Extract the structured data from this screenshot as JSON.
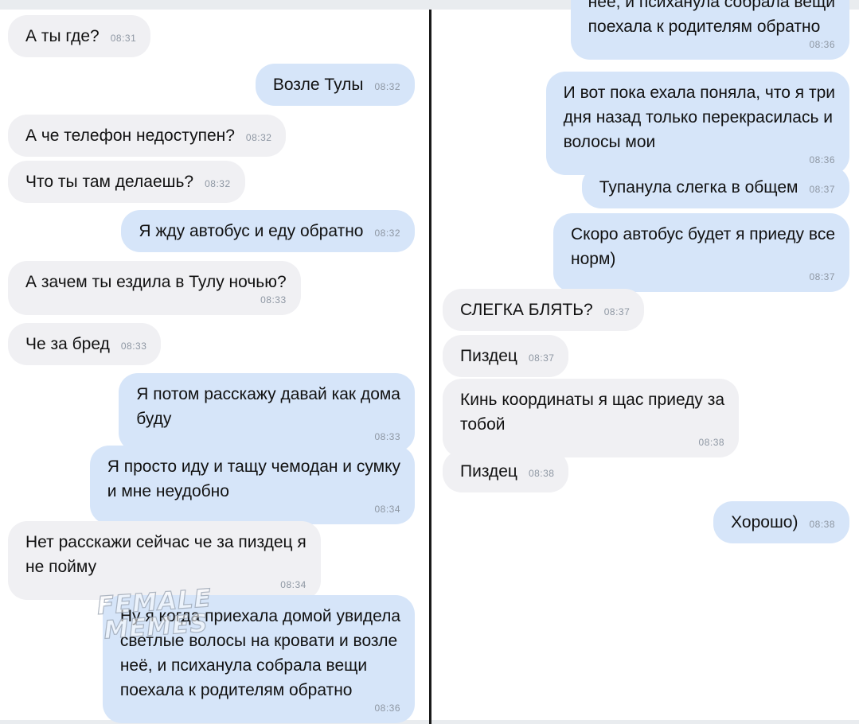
{
  "chat": {
    "left_messages": [
      {
        "dir": "in",
        "text": "А ты где?",
        "time": "08:31"
      },
      {
        "dir": "out",
        "text": "Возле Тулы",
        "time": "08:32"
      },
      {
        "dir": "in",
        "text": "А че телефон недоступен?",
        "time": "08:32"
      },
      {
        "dir": "in",
        "text": "Что ты там делаешь?",
        "time": "08:32"
      },
      {
        "dir": "out",
        "text": "Я жду автобус и еду обратно",
        "time": "08:32"
      },
      {
        "dir": "in",
        "text": "А зачем ты ездила в Тулу ночью?",
        "time": "08:33"
      },
      {
        "dir": "in",
        "text": "Че за бред",
        "time": "08:33"
      },
      {
        "dir": "out",
        "text": "Я потом расскажу давай как дома\nбуду",
        "time": "08:33"
      },
      {
        "dir": "out",
        "text": "Я просто иду и тащу чемодан и сумку\nи мне неудобно",
        "time": "08:34"
      },
      {
        "dir": "in",
        "text": "Нет расскажи сейчас че за пиздец я\nне пойму",
        "time": "08:34"
      },
      {
        "dir": "out",
        "text": "Ну я когда приехала домой  увидела\nсветлые волосы на кровати и возле\nнеё, и психанула собрала вещи\nпоехала к родителям обратно",
        "time": "08:36"
      }
    ],
    "right_messages": [
      {
        "dir": "out",
        "text": "неё, и психанула собрала вещи\nпоехала к родителям обратно",
        "time": "08:36"
      },
      {
        "dir": "out",
        "text": "И вот пока ехала поняла, что я три\nдня назад только перекрасилась и\nволосы мои",
        "time": "08:36"
      },
      {
        "dir": "out",
        "text": "Тупанула слегка в общем",
        "time": "08:37"
      },
      {
        "dir": "out",
        "text": "Скоро автобус будет я приеду все\nнорм)",
        "time": "08:37"
      },
      {
        "dir": "in",
        "text": "СЛЕГКА БЛЯТЬ?",
        "time": "08:37"
      },
      {
        "dir": "in",
        "text": "Пиздец",
        "time": "08:37"
      },
      {
        "dir": "in",
        "text": "Кинь координаты я щас приеду за\nтобой",
        "time": "08:38"
      },
      {
        "dir": "in",
        "text": "Пиздец",
        "time": "08:38"
      },
      {
        "dir": "out",
        "text": "Хорошо)",
        "time": "08:38"
      }
    ]
  },
  "watermark": {
    "line1": "FEMALE",
    "line2": "MEMES"
  },
  "colors": {
    "incoming_bubble": "#f0f0f3",
    "outgoing_bubble": "#d6e5f9",
    "timestamp": "#8e97a3",
    "divider": "#1a1a1a"
  }
}
